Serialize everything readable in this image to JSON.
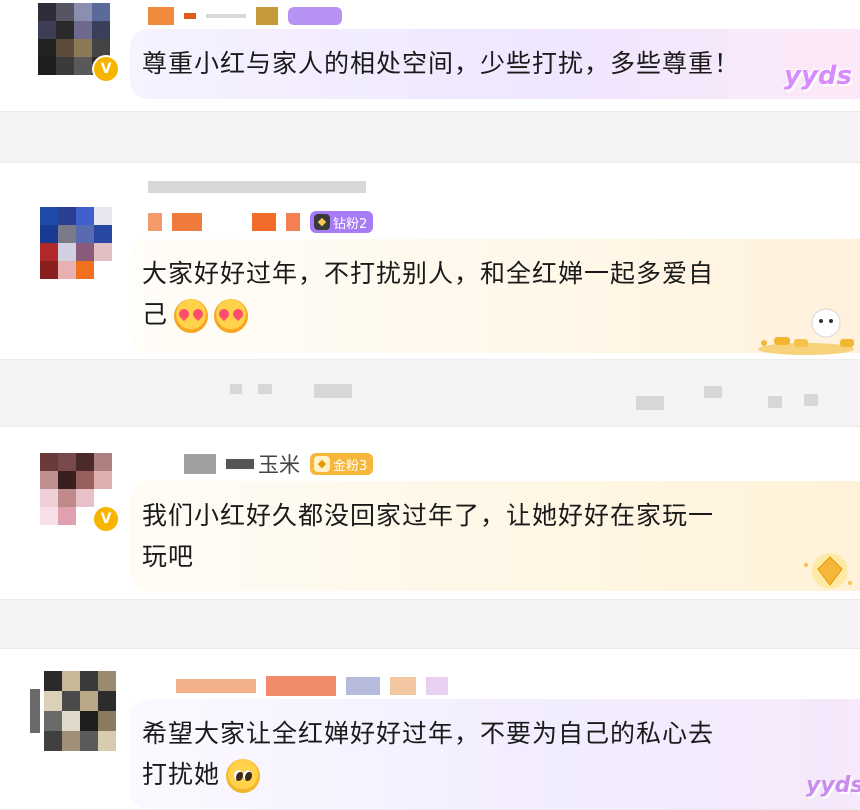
{
  "colors": {
    "page_bg": "#f4f4f6",
    "bubble_purple": "#f1ecff",
    "bubble_yellow": "#fff8e6",
    "fan_badge_purple": "#a57cf6",
    "fan_badge_gold": "#f6b63a",
    "vip_gold": "#f7b500"
  },
  "comments": [
    {
      "text": "尊重小红与家人的相处空间，少些打扰，多些尊重！",
      "decoration": "yyds",
      "emojis": []
    },
    {
      "fan_badge": "钻粉2",
      "text_line1": "大家好好过年，不打扰别人，和全红婵一起多爱自",
      "text_line2": "己",
      "emojis": [
        "heart-eyes-emoji",
        "heart-eyes-emoji"
      ]
    },
    {
      "name_visible": "玉米",
      "fan_badge": "金粉3",
      "text_line1": "我们小红好久都没回家过年了，让她好好在家玩一",
      "text_line2": "玩吧",
      "emojis": []
    },
    {
      "text_line1": "希望大家让全红婵好好过年，不要为自己的私心去",
      "text_line2": "打扰她",
      "decoration": "yyds",
      "emojis": [
        "pleading-emoji"
      ]
    }
  ]
}
